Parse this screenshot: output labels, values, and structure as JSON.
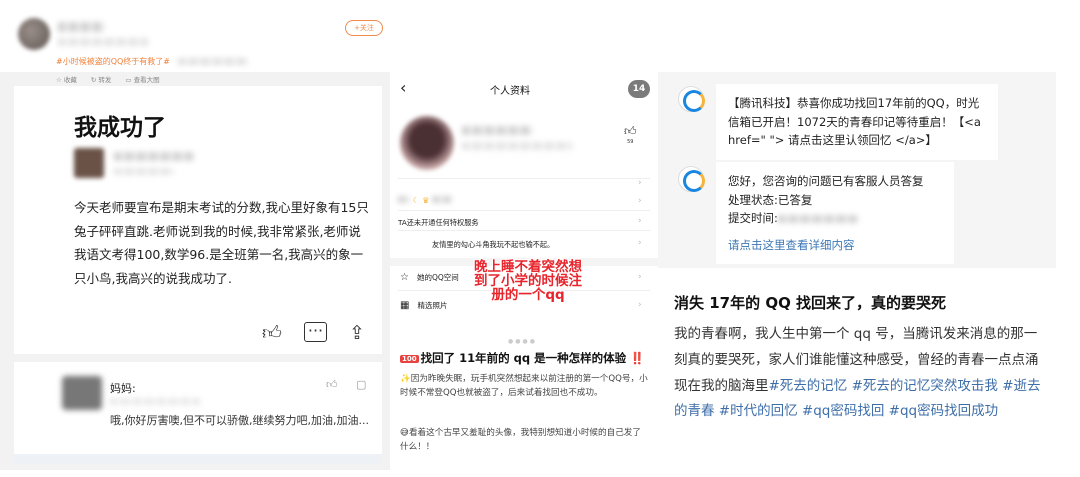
{
  "left": {
    "follow_label": "+关注",
    "tagline": "#小时候被盗的QQ终于有救了#",
    "tools": [
      "收藏",
      "转发",
      "查看大图"
    ],
    "post_title": "我成功了",
    "post_body": "今天老师要宣布是期末考试的分数,我心里好象有15只兔子砰砰直跳.老师说到我的时候,我非常紧张,老师说我语文考得100,数学96.是全班第一名,我高兴的象一只小鸟,我高兴的说我成功了.",
    "actions": [
      "like-icon",
      "comment-icon",
      "share-icon"
    ],
    "comment": {
      "name": "妈妈:",
      "text": "哦,你好厉害噢,但不可以骄傲,继续努力吧,加油,加油..."
    }
  },
  "middle": {
    "nav_title": "个人资料",
    "badge": "14",
    "like_count": "59",
    "privilege_text": "TA还未开通任何特权服务",
    "signature": "友情里的勾心斗角我玩不起也输不起。",
    "sections": [
      {
        "icon": "star-icon",
        "label": "她的QQ空间"
      },
      {
        "icon": "grid-icon",
        "label": "精选照片"
      }
    ],
    "overlay_text": "晚上睡不着突然想到了小学的时候注册的一个qq",
    "post_badge": "100",
    "post_title": "找回了 11年前的 qq 是一种怎样的体验",
    "post_bang": "‼️",
    "para1": "✨因为昨晚失眠，玩手机突然想起来以前注册的第一个QQ号，小时候不常登QQ也就被盗了，后来试着找回也不成功。",
    "para2": "😅看着这个古早又羞耻的头像，我特别想知道小时候的自己发了什么！！"
  },
  "right": {
    "msg1": "【腾讯科技】恭喜你成功找回17年前的QQ，时光信箱已开启！1072天的青春印记等待重启！【<a href=\" \"> 请点击这里认领回忆 </a>】",
    "msg2_line1": "您好，您咨询的问题已有客服人员答复",
    "msg2_line2": "处理状态:已答复",
    "msg2_line3": "提交时间:",
    "msg2_link": "请点击这里查看详细内容",
    "title": "消失 17年的 QQ 找回来了，真的要哭死",
    "body_plain": "我的青春啊，我人生中第一个 qq 号，当腾讯发来消息的那一刻真的要哭死，家人们谁能懂这种感受，曾经的青春一点点涌现在我的脑海里",
    "body_tags": "#死去的记忆 #死去的记忆突然攻击我 #逝去的青春 #时代的回忆 #qq密码找回 #qq密码找回成功"
  }
}
